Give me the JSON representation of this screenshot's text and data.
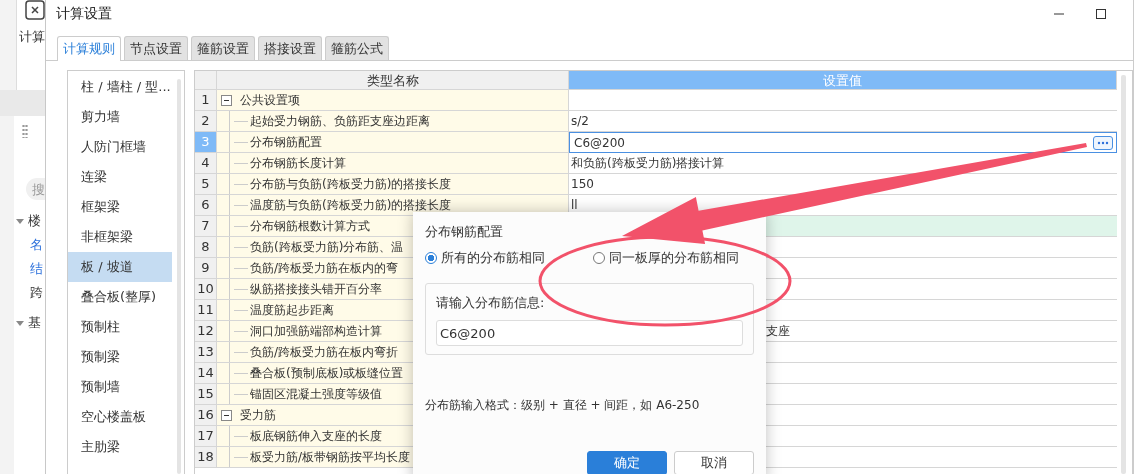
{
  "background_app": {
    "toolbar_label": "计算",
    "search_placeholder": "搜",
    "sections": [
      {
        "label": "楼",
        "expanded": true
      },
      {
        "label": "基",
        "expanded": true
      }
    ],
    "properties": [
      {
        "label": "名",
        "kind": "link"
      },
      {
        "label": "结",
        "kind": "link"
      },
      {
        "label": "跨",
        "kind": "text"
      }
    ]
  },
  "window": {
    "title": "计算设置"
  },
  "tabs": [
    {
      "label": "计算规则",
      "selected": true
    },
    {
      "label": "节点设置",
      "selected": false
    },
    {
      "label": "箍筋设置",
      "selected": false
    },
    {
      "label": "搭接设置",
      "selected": false
    },
    {
      "label": "箍筋公式",
      "selected": false
    }
  ],
  "categories": [
    {
      "label": "柱 / 墙柱 / 型...",
      "selected": false
    },
    {
      "label": "剪力墙",
      "selected": false
    },
    {
      "label": "人防门框墙",
      "selected": false
    },
    {
      "label": "连梁",
      "selected": false
    },
    {
      "label": "框架梁",
      "selected": false
    },
    {
      "label": "非框架梁",
      "selected": false
    },
    {
      "label": "板 / 坡道",
      "selected": true
    },
    {
      "label": "叠合板(整厚)",
      "selected": false
    },
    {
      "label": "预制柱",
      "selected": false
    },
    {
      "label": "预制梁",
      "selected": false
    },
    {
      "label": "预制墙",
      "selected": false
    },
    {
      "label": "空心楼盖板",
      "selected": false
    },
    {
      "label": "主肋梁",
      "selected": false
    }
  ],
  "table": {
    "columns": [
      "类型名称",
      "设置值"
    ],
    "rows": [
      {
        "no": "1",
        "name": "公共设置项",
        "kind": "group",
        "expanded": true,
        "selected": false,
        "highlighted": false
      },
      {
        "no": "2",
        "name": "起始受力钢筋、负筋距支座边距离",
        "kind": "item",
        "value": "s/2",
        "selected": false,
        "highlighted": false
      },
      {
        "no": "3",
        "name": "分布钢筋配置",
        "kind": "item",
        "value": "C6@200",
        "selected": true,
        "highlighted": false
      },
      {
        "no": "4",
        "name": "分布钢筋长度计算",
        "kind": "item",
        "value": "和负筋(跨板受力筋)搭接计算",
        "selected": false,
        "highlighted": false
      },
      {
        "no": "5",
        "name": "分布筋与负筋(跨板受力筋)的搭接长度",
        "kind": "item",
        "value": "150",
        "selected": false,
        "highlighted": false
      },
      {
        "no": "6",
        "name": "温度筋与负筋(跨板受力筋)的搭接长度",
        "kind": "item",
        "value": "ll",
        "selected": false,
        "highlighted": false
      },
      {
        "no": "7",
        "name": "分布钢筋根数计算方式",
        "kind": "item",
        "selected": false,
        "highlighted": true
      },
      {
        "no": "8",
        "name": "负筋(跨板受力筋)分布筋、温",
        "kind": "item",
        "selected": false,
        "highlighted": false
      },
      {
        "no": "9",
        "name": "负筋/跨板受力筋在板内的弯",
        "kind": "item",
        "selected": false,
        "highlighted": false
      },
      {
        "no": "10",
        "name": "纵筋搭接接头错开百分率",
        "kind": "item",
        "selected": false,
        "highlighted": false
      },
      {
        "no": "11",
        "name": "温度筋起步距离",
        "kind": "item",
        "selected": false,
        "highlighted": false
      },
      {
        "no": "12",
        "name": "洞口加强筋端部构造计算",
        "kind": "item",
        "value": "支座",
        "selected": false,
        "highlighted": false
      },
      {
        "no": "13",
        "name": "负筋/跨板受力筋在板内弯折",
        "kind": "item",
        "selected": false,
        "highlighted": false
      },
      {
        "no": "14",
        "name": "叠合板(预制底板)或板缝位置",
        "kind": "item",
        "selected": false,
        "highlighted": false
      },
      {
        "no": "15",
        "name": "锚固区混凝土强度等级值",
        "kind": "item",
        "selected": false,
        "highlighted": false
      },
      {
        "no": "16",
        "name": "受力筋",
        "kind": "group",
        "expanded": true,
        "selected": false,
        "highlighted": false
      },
      {
        "no": "17",
        "name": "板底钢筋伸入支座的长度",
        "kind": "item",
        "selected": false,
        "highlighted": false
      },
      {
        "no": "18",
        "name": "板受力筋/板带钢筋按平均长度",
        "kind": "item",
        "selected": false,
        "highlighted": false
      }
    ]
  },
  "dialog": {
    "title": "分布钢筋配置",
    "options": [
      {
        "label": "所有的分布筋相同",
        "selected": true
      },
      {
        "label": "同一板厚的分布筋相同",
        "selected": false
      }
    ],
    "field_label": "请输入分布筋信息:",
    "field_value": "C6@200",
    "hint": "分布筋输入格式：级别 + 直径 + 间距，如 A6-250",
    "buttons": [
      {
        "label": "确定",
        "primary": true
      },
      {
        "label": "取消",
        "primary": false
      }
    ]
  }
}
